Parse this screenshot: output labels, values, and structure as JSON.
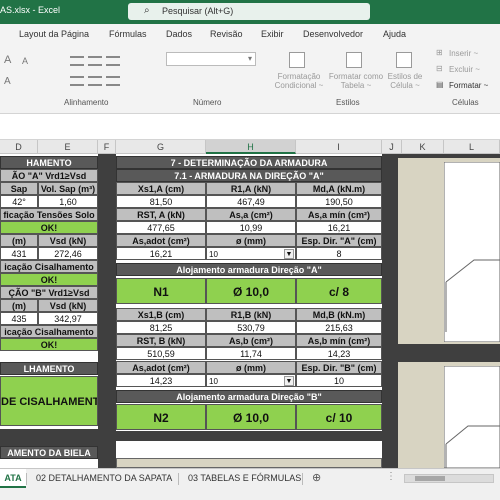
{
  "titlebar": {
    "filename": "AS.xlsx  -  Excel",
    "search_placeholder": "Pesquisar (Alt+G)"
  },
  "tabs": [
    "Layout da Página",
    "Fórmulas",
    "Dados",
    "Revisão",
    "Exibir",
    "Desenvolvedor",
    "Ajuda"
  ],
  "ribbon": {
    "groups": {
      "alinhamento": "Alinhamento",
      "numero": "Número",
      "estilos": "Estilos",
      "celulas": "Células"
    },
    "estilos_btns": {
      "cond_1": "Formatação",
      "cond_2": "Condicional ~",
      "tab_1": "Formatar como",
      "tab_2": "Tabela ~",
      "cel_1": "Estilos de",
      "cel_2": "Célula ~"
    },
    "celulas_btns": {
      "inserir": "Inserir ~",
      "excluir": "Excluir ~",
      "formatar": "Formatar ~"
    }
  },
  "columns": [
    "D",
    "E",
    "F",
    "G",
    "H",
    "I",
    "J",
    "K",
    "L"
  ],
  "left": {
    "title": "HAMENTO",
    "dirA": "ÃO \"A\"  Vrd1≥Vsd",
    "h1": "Sap",
    "h2": "Vol. Sap (m³)",
    "v1": "42°",
    "v2": "1,60",
    "verif_solo": "ficação Tensões Solo",
    "ok1": "OK!",
    "h3": "(m)",
    "h4": "Vsd (kN)",
    "v3": "431",
    "v4": "272,46",
    "verif_cis": "icação Cisalhamento",
    "ok2": "OK!",
    "dirB": "ÇÃO \"B\"  Vrd1≥Vsd",
    "h5": "(m)",
    "h6": "Vsd (kN)",
    "v5": "435",
    "v6": "342,97",
    "verif_cis2": "icação Cisalhamento",
    "ok3": "OK!",
    "hamento2": "LHAMENTO",
    "cis_big": "DE CISALHAMENTO",
    "biela": "AMENTO DA BIELA"
  },
  "main": {
    "title": "7 - DETERMINAÇÃO DA  ARMADURA",
    "sub_a": "7.1 - ARMADURA NA DIREÇÃO \"A\"",
    "a_h1": [
      "Xs1,A (cm)",
      "R1,A (kN)",
      "Md,A (kN.m)"
    ],
    "a_v1": [
      "81,50",
      "467,49",
      "190,50"
    ],
    "a_h2": [
      "RST, A (kN)",
      "As,a (cm²)",
      "As,a mín (cm²)"
    ],
    "a_v2": [
      "477,65",
      "10,99",
      "16,21"
    ],
    "a_h3": [
      "As,adot (cm²)",
      "ø (mm)",
      "Esp. Dir. \"A\" (cm)"
    ],
    "a_v3": {
      "as": "16,21",
      "phi": "10",
      "esp": "8"
    },
    "aloj_a": "Alojamento armadura Direção \"A\"",
    "n1": {
      "label": "N1",
      "bar": "Ø 10,0",
      "spacing": "c/ 8"
    },
    "b_h1": [
      "Xs1,B (cm)",
      "R1,B (kN)",
      "Md,B (kN.m)"
    ],
    "b_v1": [
      "81,25",
      "530,79",
      "215,63"
    ],
    "b_h2": [
      "RST, B (kN)",
      "As,b (cm²)",
      "As,b mín (cm²)"
    ],
    "b_v2": [
      "510,59",
      "11,74",
      "14,23"
    ],
    "b_h3": [
      "As,adot (cm²)",
      "ø (mm)",
      "Esp. Dir. \"B\" (cm)"
    ],
    "b_v3": {
      "as": "14,23",
      "phi": "10",
      "esp": "10"
    },
    "aloj_b": "Alojamento armadura Direção \"B\"",
    "n2": {
      "label": "N2",
      "bar": "Ø 10,0",
      "spacing": "c/ 10"
    }
  },
  "sheets": {
    "active": "ATA",
    "s2": "02 DETALHAMENTO DA SAPATA",
    "s3": "03 TABELAS E FÓRMULAS"
  },
  "colors": {
    "excel_green": "#217346",
    "ok_green": "#8fd14f",
    "header_dark": "#595959",
    "label_gray": "#bfbfbf",
    "backdrop": "#3f3f3f"
  }
}
